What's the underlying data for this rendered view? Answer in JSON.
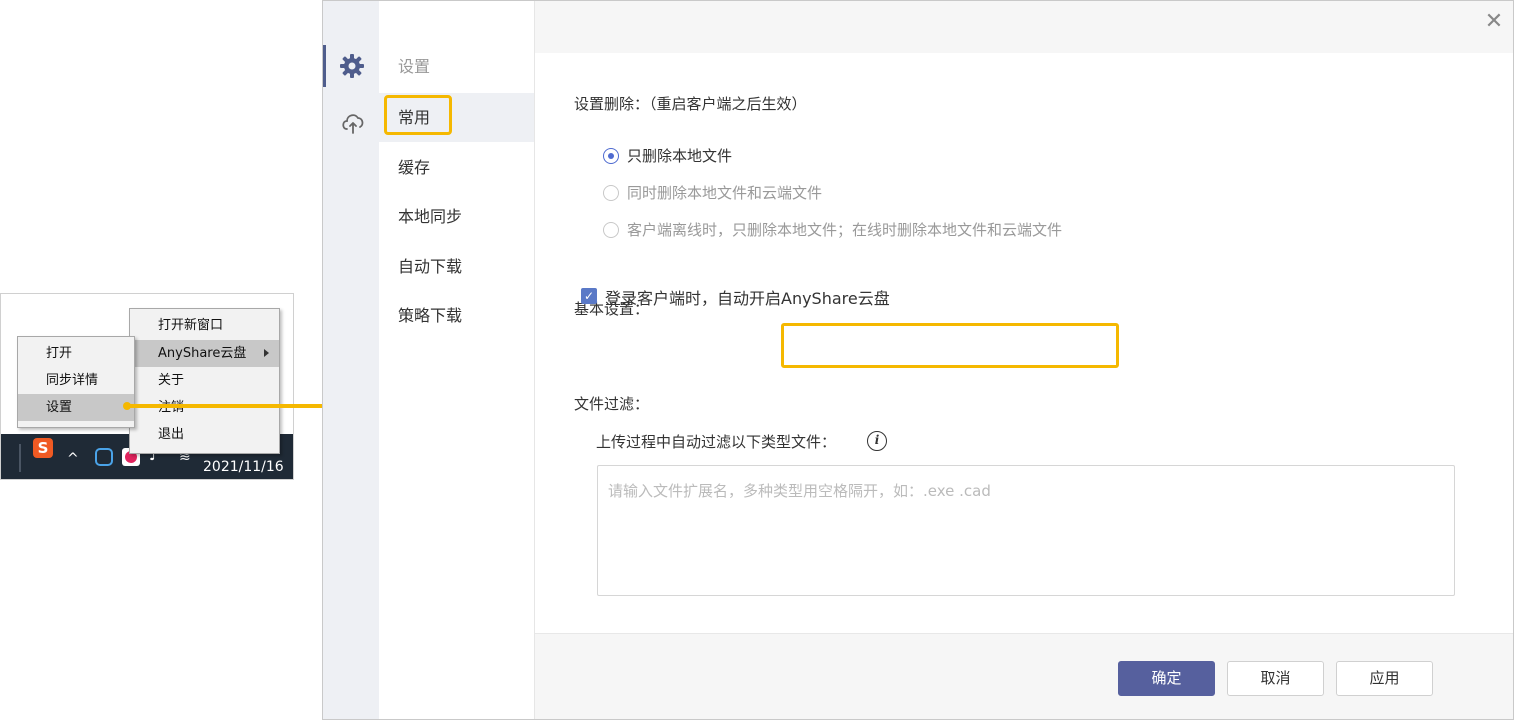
{
  "tray_snippet": {
    "context_menu": {
      "items": [
        "打开",
        "同步详情",
        "设置"
      ],
      "highlighted_index": 2
    },
    "submenu": {
      "items": [
        "打开新窗口",
        "AnyShare云盘",
        "关于",
        "注销",
        "退出"
      ],
      "highlighted_index": 1
    },
    "taskbar": {
      "sogou_label": "S",
      "tray_chevron": "^",
      "clock": "2021/11/16"
    }
  },
  "dialog": {
    "nav_title": "设置",
    "nav_items": [
      "常用",
      "缓存",
      "本地同步",
      "自动下载",
      "策略下载"
    ],
    "active_nav_index": 0,
    "close_glyph": "✕",
    "delete_settings": {
      "label": "设置删除：（重启客户端之后生效）",
      "options": [
        "只删除本地文件",
        "同时删除本地文件和云端文件",
        "客户端离线时，只删除本地文件；在线时删除本地文件和云端文件"
      ],
      "selected_index": 0
    },
    "basic_settings": {
      "label": "基本设置：",
      "auto_start_label": "登录客户端时，自动开启AnyShare云盘",
      "auto_start_checked": true
    },
    "file_filter": {
      "label": "文件过滤：",
      "sub_label": "上传过程中自动过滤以下类型文件：",
      "info_glyph": "i",
      "input_value": "",
      "input_placeholder": "请输入文件扩展名，多种类型用空格隔开，如：.exe .cad"
    },
    "footer": {
      "confirm_label": "确定",
      "cancel_label": "取消",
      "apply_label": "应用"
    }
  },
  "colors": {
    "highlight_accent": "#f5b800",
    "primary_button": "#56609e",
    "checkbox": "#5a79c7",
    "radio_selected": "#4f6bd0"
  }
}
